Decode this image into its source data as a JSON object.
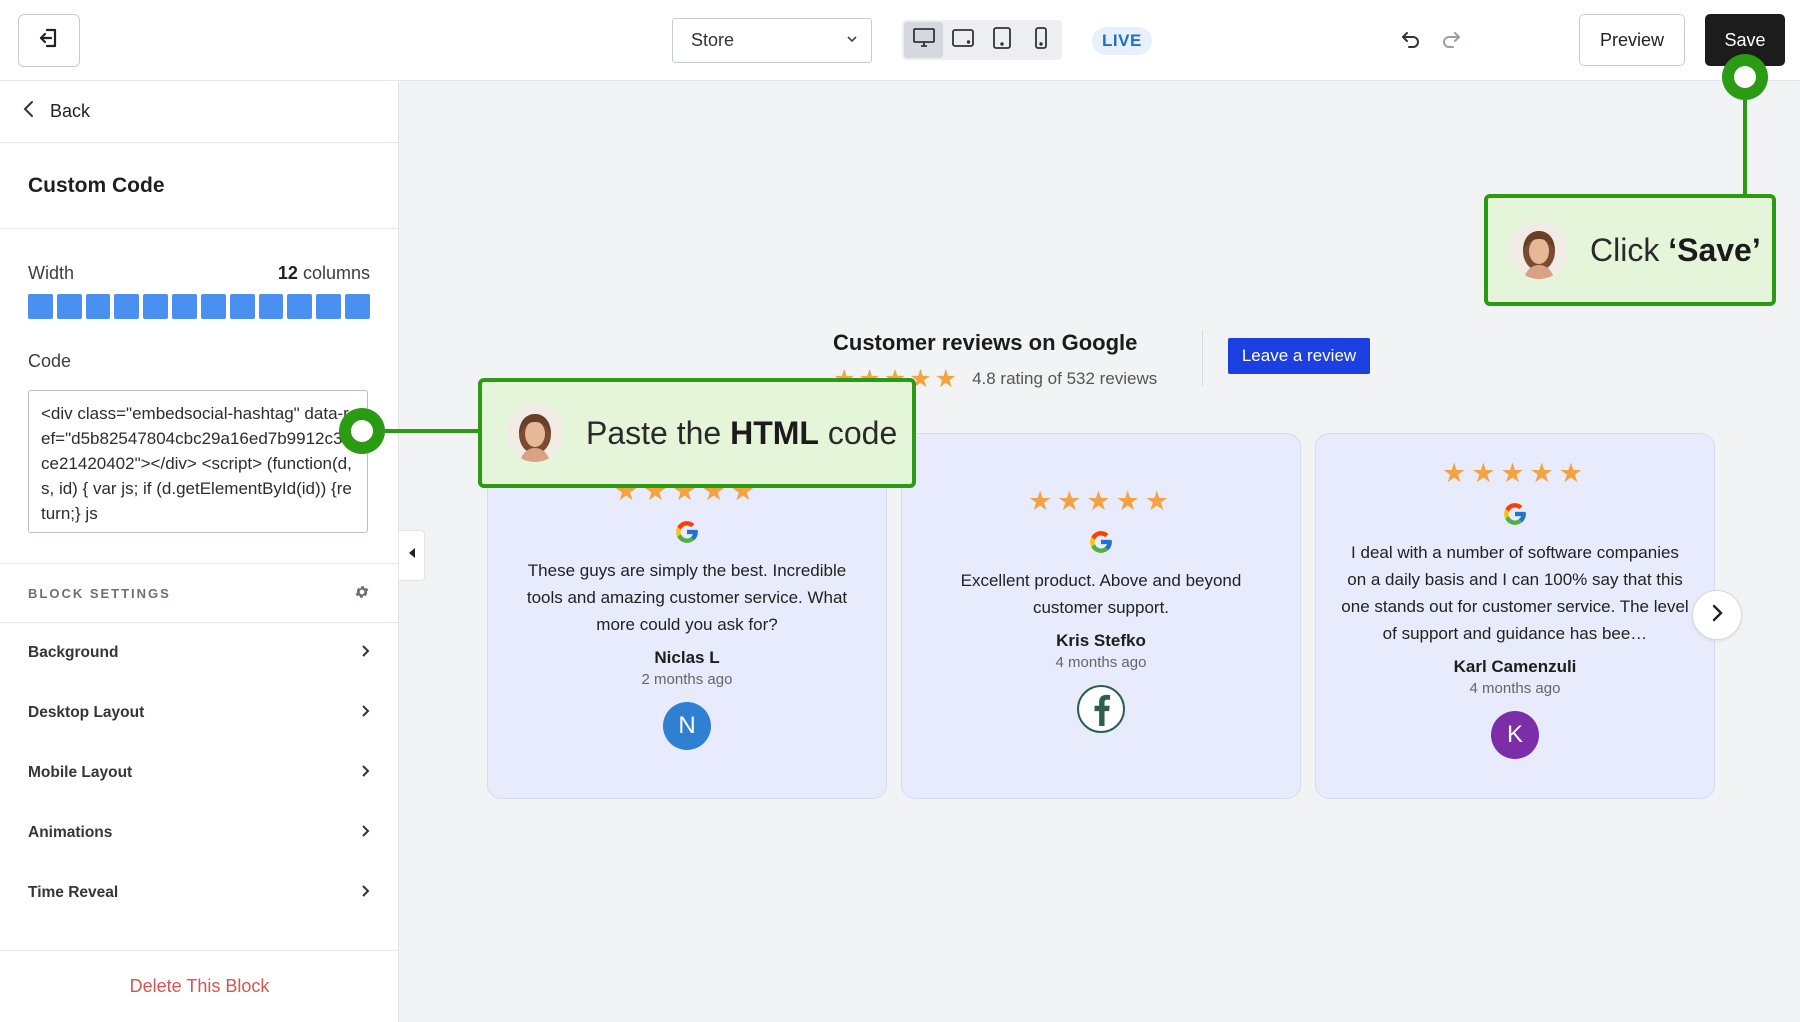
{
  "topbar": {
    "store_select": "Store",
    "live_badge": "LIVE",
    "preview_label": "Preview",
    "save_label": "Save"
  },
  "sidebar": {
    "back_label": "Back",
    "section_title": "Custom Code",
    "width_label": "Width",
    "width_value": "12",
    "width_unit": "columns",
    "width_columns": 12,
    "code_label": "Code",
    "code_value": "<div class=\"embedsocial-hashtag\" data-ref=\"d5b82547804cbc29a16ed7b9912c36ce21420402\"></div> <script> (function(d, s, id) { var js; if (d.getElementById(id)) {return;} js",
    "block_settings_label": "BLOCK SETTINGS",
    "settings_items": [
      {
        "label": "Background"
      },
      {
        "label": "Desktop Layout"
      },
      {
        "label": "Mobile Layout"
      },
      {
        "label": "Animations"
      },
      {
        "label": "Time Reveal"
      }
    ],
    "delete_label": "Delete This Block"
  },
  "widget": {
    "title": "Customer reviews on Google",
    "stars": "★★★★★",
    "rating_text": "4.8 rating of 532 reviews",
    "leave_review_label": "Leave a review",
    "reviews": [
      {
        "stars": "★★★★★",
        "text": "These guys are simply the best. Incredible tools and amazing customer service. What more could you ask for?",
        "name": "Niclas L",
        "time": "2 months ago",
        "avatar_letter": "N",
        "avatar_color": "#2f7fd3"
      },
      {
        "stars": "★★★★★",
        "text": "Excellent product. Above and beyond customer support.",
        "name": "Kris Stefko",
        "time": "4 months ago",
        "avatar_letter": "f",
        "avatar_color": "#2d5e4f"
      },
      {
        "stars": "★★★★★",
        "text": "I deal with a number of software companies on a daily basis and I can 100% say that this one stands out for customer service. The level of support and guidance has bee…",
        "name": "Karl Camenzuli",
        "time": "4 months ago",
        "avatar_letter": "K",
        "avatar_color": "#7b2ea8"
      }
    ]
  },
  "callouts": {
    "paste_prefix": "Paste the ",
    "paste_bold": "HTML",
    "paste_suffix": " code",
    "save_prefix": "Click ",
    "save_bold": "‘Save’"
  },
  "colors": {
    "accent_green": "#2a9b12",
    "callout_bg": "#e4f5d9",
    "column_blue": "#4a90f0",
    "leave_review_blue": "#1b3fe0",
    "star_orange": "#f4a340",
    "card_bg": "#e7ebfb",
    "delete_red": "#d9534f"
  },
  "icons": [
    "exit-icon",
    "chevron-down-icon",
    "desktop-icon",
    "tablet-landscape-icon",
    "tablet-portrait-icon",
    "mobile-icon",
    "undo-icon",
    "redo-icon",
    "chevron-left-icon",
    "gear-icon",
    "chevron-right-icon",
    "google-icon",
    "facebook-icon"
  ]
}
